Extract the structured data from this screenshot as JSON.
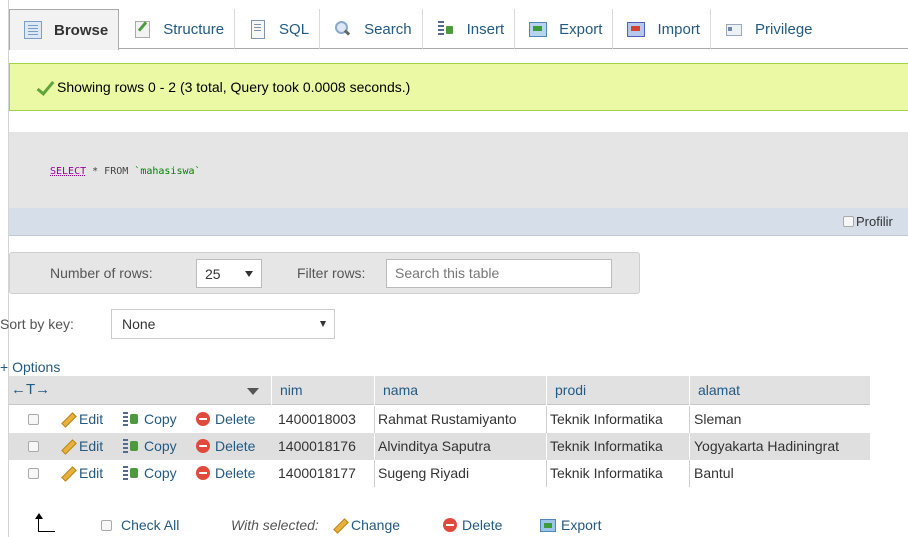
{
  "tabs": [
    {
      "label": "Browse",
      "icon": "browse-icon",
      "active": true
    },
    {
      "label": "Structure",
      "icon": "structure-icon"
    },
    {
      "label": "SQL",
      "icon": "sql-icon"
    },
    {
      "label": "Search",
      "icon": "search-icon"
    },
    {
      "label": "Insert",
      "icon": "insert-icon"
    },
    {
      "label": "Export",
      "icon": "export-icon"
    },
    {
      "label": "Import",
      "icon": "import-icon"
    },
    {
      "label": "Privilege",
      "icon": "privileges-icon"
    }
  ],
  "message": {
    "text": "Showing rows 0 - 2 (3 total, Query took 0.0008 seconds.)",
    "color": "#ebf8a4"
  },
  "query": {
    "select": "SELECT",
    "star_from": " * FROM ",
    "table": "`mahasiswa`"
  },
  "profiling": {
    "label": "Profilir"
  },
  "nav": {
    "number_of_rows_label": "Number of rows:",
    "number_of_rows_value": "25",
    "filter_label": "Filter rows:",
    "filter_placeholder": "Search this table"
  },
  "sort": {
    "label": "Sort by key:",
    "value": "None"
  },
  "options_label": "+ Options",
  "table": {
    "arrows": "←T→",
    "columns": [
      "nim",
      "nama",
      "prodi",
      "alamat"
    ],
    "action_labels": {
      "edit": "Edit",
      "copy": "Copy",
      "delete": "Delete"
    },
    "rows": [
      {
        "nim": "1400018003",
        "nama": "Rahmat Rustamiyanto",
        "prodi": "Teknik Informatika",
        "alamat": "Sleman"
      },
      {
        "nim": "1400018176",
        "nama": "Alvinditya Saputra",
        "prodi": "Teknik Informatika",
        "alamat": "Yogyakarta Hadiningrat"
      },
      {
        "nim": "1400018177",
        "nama": "Sugeng Riyadi",
        "prodi": "Teknik Informatika",
        "alamat": "Bantul"
      }
    ]
  },
  "footer": {
    "check_all": "Check All",
    "with_selected": "With selected:",
    "change": "Change",
    "delete": "Delete",
    "export": "Export"
  },
  "colors": {
    "link": "#235a81",
    "success_border": "#a2d246",
    "row_alt": "#dfdfdf"
  }
}
